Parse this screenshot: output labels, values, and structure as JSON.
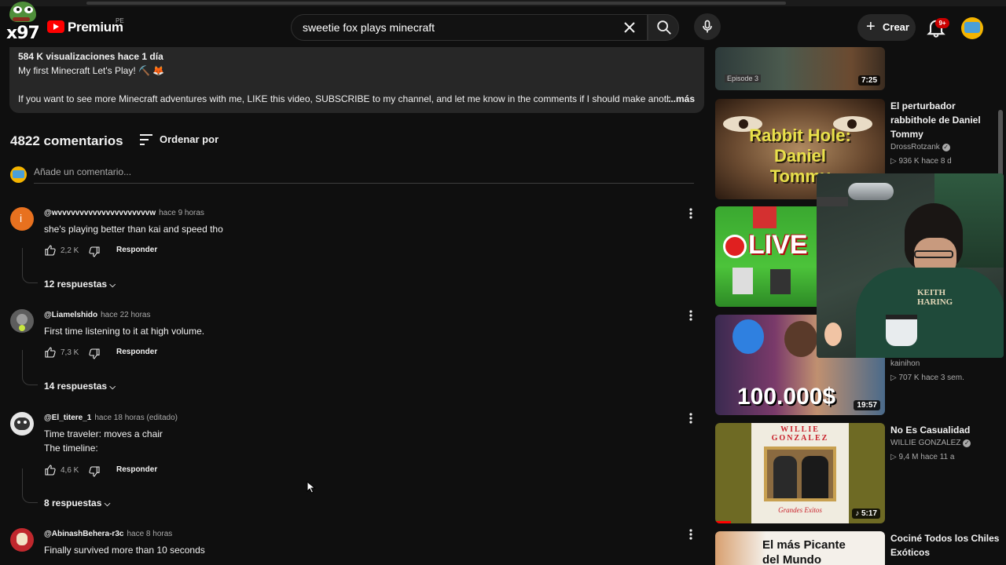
{
  "header": {
    "brand": "Premium",
    "country": "PE",
    "streamer_tag": "x97",
    "search_value": "sweetie fox plays minecraft",
    "create_label": "Crear",
    "notif_badge": "9+"
  },
  "description": {
    "stats": "584 K visualizaciones  hace 1 día",
    "title_line": "My first Minecraft Let's Play! ⛏️ 🦊",
    "body": "If you want to see more Minecraft adventures with me, LIKE this video, SUBSCRIBE to my channel, and let me know in the comments if I should make another pa",
    "more_label": "...más"
  },
  "comments_section": {
    "count_label": "4822 comentarios",
    "sort_label": "Ordenar por",
    "add_placeholder": "Añade un comentario..."
  },
  "comments": [
    {
      "author": "@wvvvvvvvvvvvvvvvvvvvvvw",
      "time": "hace 9 horas",
      "text": "she's playing better than kai and speed tho",
      "likes": "2,2 K",
      "reply_label": "Responder",
      "replies": "12 respuestas",
      "avatar_letter": "i",
      "avatar_color": "#e8711f"
    },
    {
      "author": "@Liamelshido",
      "time": "hace 22 horas",
      "text": "First time listening to it at high volume.",
      "likes": "7,3 K",
      "reply_label": "Responder",
      "replies": "14 respuestas",
      "avatar_color": "#6b6b6b"
    },
    {
      "author": "@El_titere_1",
      "time": "hace 18 horas (editado)",
      "text_line1": "Time traveler: moves a chair",
      "text_line2": "The timeline:",
      "likes": "4,6 K",
      "reply_label": "Responder",
      "replies": "8 respuestas",
      "avatar_color": "#d9d9d9"
    },
    {
      "author": "@AbinashBehera-r3c",
      "time": "hace 8 horas",
      "text": "Finally survived more than 10 seconds",
      "avatar_color": "#c0282d"
    }
  ],
  "sidebar": {
    "videos": [
      {
        "thumb_text": "Episode 3",
        "duration": "7:25"
      },
      {
        "thumb_text": "Rabbit Hole: Daniel Tommy",
        "title": "El perturbador rabbithole de Daniel Tommy",
        "channel": "DrossRotzank",
        "meta": "▷ 936 K  hace 8 d"
      },
      {
        "thumb_text": "LIVE"
      },
      {
        "thumb_text": "100.000$",
        "duration": "19:57",
        "channel": "kainihon",
        "meta": "▷ 707 K  hace 3 sem."
      },
      {
        "thumb_text": "WILLIE GONZALEZ",
        "thumb_sub": "Grandes Exitos",
        "duration": "♪ 5:17",
        "title": "No Es Casualidad",
        "channel": "WILLIE GONZALEZ",
        "meta": "▷ 9,4 M  hace 11 a"
      },
      {
        "thumb_text": "El más Picante del Mundo",
        "title": "Cociné Todos los Chiles Exóticos"
      }
    ]
  },
  "colors": {
    "background": "#0f0f0f",
    "surface": "#272727",
    "accent_red": "#ff0000",
    "text_primary": "#f1f1f1",
    "text_secondary": "#aaaaaa"
  }
}
